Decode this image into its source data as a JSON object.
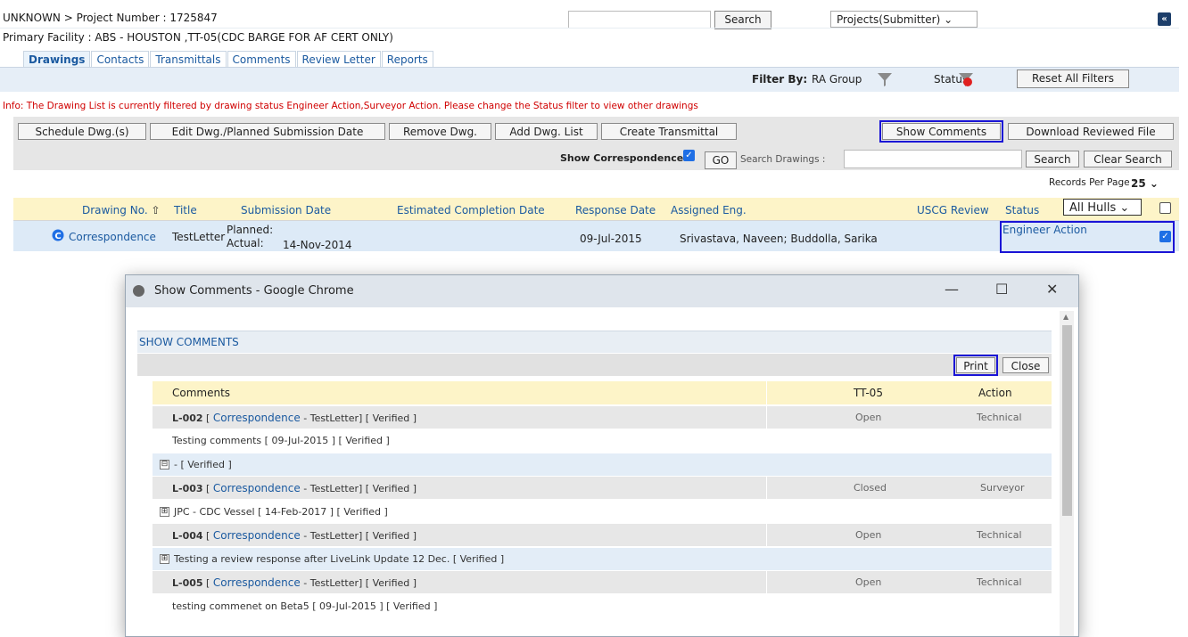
{
  "header": {
    "breadcrumb": "UNKNOWN > Project Number : 1725847",
    "facility": "Primary Facility : ABS - HOUSTON ,TT-05(CDC BARGE FOR AF CERT ONLY)",
    "search_label": "Search",
    "project_select": "Projects(Submitter)",
    "collapse_icon": "«"
  },
  "tabs": [
    "Drawings",
    "Contacts",
    "Transmittals",
    "Comments",
    "Review Letter",
    "Reports"
  ],
  "filter": {
    "filter_by": "Filter By:",
    "ra_group": "RA Group",
    "status": "Status",
    "reset": "Reset All Filters"
  },
  "info": "Info: The Drawing List is currently filtered by drawing status Engineer Action,Surveyor Action. Please change the Status filter to view other drawings",
  "toolbar": {
    "schedule": "Schedule Dwg.(s)",
    "edit": "Edit Dwg./Planned Submission Date",
    "remove": "Remove Dwg.",
    "add_list": "Add Dwg. List",
    "create_transmittal": "Create Transmittal",
    "show_comments": "Show Comments",
    "download_reviewed": "Download Reviewed File",
    "show_correspondence": "Show Correspondence:",
    "go": "GO",
    "search_drawings": "Search Drawings :",
    "search": "Search",
    "clear_search": "Clear Search"
  },
  "records_per_page": {
    "label": "Records Per Page :",
    "value": "25"
  },
  "table": {
    "headers": {
      "drawing_no": "Drawing No.",
      "title": "Title",
      "submission_date": "Submission Date",
      "estimated_completion": "Estimated Completion Date",
      "response_date": "Response Date",
      "assigned_eng": "Assigned Eng.",
      "uscg_review": "USCG Review",
      "status": "Status",
      "hulls": "All Hulls"
    },
    "row": {
      "drawing_no": "Correspondence",
      "title": "TestLetter",
      "planned_label": "Planned:",
      "actual_label": "Actual:",
      "actual_date": "14-Nov-2014",
      "response_date": "09-Jul-2015",
      "assigned_eng": "Srivastava, Naveen; Buddolla, Sarika",
      "status": "Engineer Action"
    }
  },
  "popup": {
    "window_title": "Show Comments - Google Chrome",
    "minimize": "—",
    "maximize": "☐",
    "close": "✕",
    "section_title": "SHOW COMMENTS",
    "print": "Print",
    "close_btn": "Close",
    "col_comments": "Comments",
    "col_hull": "TT-05",
    "col_action": "Action",
    "rows": [
      {
        "id": "L-002",
        "link": "Correspondence",
        "rest": " - TestLetter] [ Verified ]",
        "status": "Open",
        "action": "Technical"
      },
      {
        "text": "Testing comments [ 09-Jul-2015 ] [ Verified ]"
      },
      {
        "text": "- [ Verified ]",
        "expander": "⊟"
      },
      {
        "id": "L-003",
        "link": "Correspondence",
        "rest": " - TestLetter] [ Verified ]",
        "status": "Closed",
        "action": "Surveyor"
      },
      {
        "text": "JPC - CDC Vessel [ 14-Feb-2017 ] [ Verified ]",
        "expander": "⊞"
      },
      {
        "id": "L-004",
        "link": "Correspondence",
        "rest": " - TestLetter] [ Verified ]",
        "status": "Open",
        "action": "Technical"
      },
      {
        "text": "Testing a review response after LiveLink Update 12 Dec. [ Verified ]",
        "expander": "⊞"
      },
      {
        "id": "L-005",
        "link": "Correspondence",
        "rest": " - TestLetter] [ Verified ]",
        "status": "Open",
        "action": "Technical"
      },
      {
        "text": "testing commenet on Beta5 [ 09-Jul-2015 ] [ Verified ]"
      }
    ]
  },
  "colors": {
    "link": "#1b5aa0",
    "highlight": "#1a14d6",
    "info": "#d00000",
    "header_yellow": "#fdf4c8"
  }
}
